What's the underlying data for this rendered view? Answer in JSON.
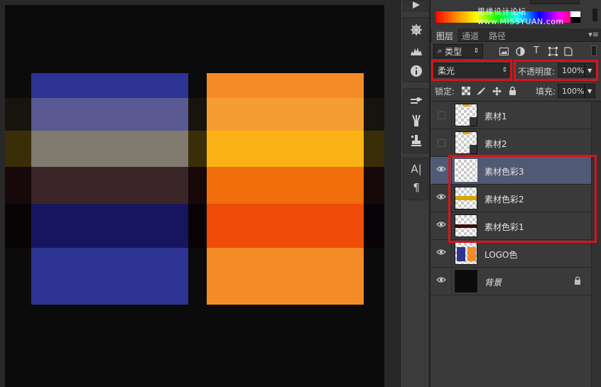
{
  "canvas": {
    "background": "#0b0b0b",
    "blocks": [
      {
        "name": "blue-block",
        "color": "#2e3493"
      },
      {
        "name": "orange-block",
        "color": "#f58b27"
      }
    ],
    "bands": [
      {
        "name": "band-1",
        "blue": "#5a5891",
        "orange": "#f69d31",
        "side": "#16140c"
      },
      {
        "name": "band-2",
        "blue": "#807a6f",
        "orange": "#fbb215",
        "side": "#3a2e08"
      },
      {
        "name": "band-3",
        "blue": "#3a2529",
        "orange": "#f26d0b",
        "side": "#170909"
      },
      {
        "name": "band-4",
        "blue": "#16155d",
        "orange": "#ef4b09",
        "side": "#080306"
      }
    ]
  },
  "color_panel": {
    "watermark": "思缘设计论坛 www.MISSYUAN.com"
  },
  "tabs": [
    {
      "label": "图层",
      "active": true
    },
    {
      "label": "通道",
      "active": false
    },
    {
      "label": "路径",
      "active": false
    }
  ],
  "filter": {
    "kind_label": "类型"
  },
  "blend": {
    "mode": "柔光",
    "opacity_label": "不透明度:",
    "opacity_value": "100%"
  },
  "lock_row": {
    "lock_label": "锁定:",
    "fill_label": "填充:",
    "fill_value": "100%"
  },
  "layers": [
    {
      "name": "素材1",
      "visible": false,
      "selected": false,
      "locked": false,
      "thumb": "doc"
    },
    {
      "name": "素材2",
      "visible": false,
      "selected": false,
      "locked": false,
      "thumb": "doc"
    },
    {
      "name": "素材色彩3",
      "visible": true,
      "selected": true,
      "locked": false,
      "thumb": "empty"
    },
    {
      "name": "素材色彩2",
      "visible": true,
      "selected": false,
      "locked": false,
      "thumb": "yellow"
    },
    {
      "name": "素材色彩1",
      "visible": true,
      "selected": false,
      "locked": false,
      "thumb": "brown"
    },
    {
      "name": "LOGO色",
      "visible": true,
      "selected": false,
      "locked": false,
      "thumb": "logo"
    },
    {
      "name": "背景",
      "visible": true,
      "selected": false,
      "locked": true,
      "thumb": "black"
    }
  ],
  "icons": {
    "play": "play-icon",
    "navigator": "navigator-icon",
    "histogram": "histogram-icon",
    "info": "info-icon",
    "brush_presets": "brush-presets-icon",
    "brush": "brush-icon",
    "clone": "clone-source-icon",
    "character": "character-icon",
    "paragraph": "paragraph-icon"
  },
  "highlight_color": "#d6141b"
}
